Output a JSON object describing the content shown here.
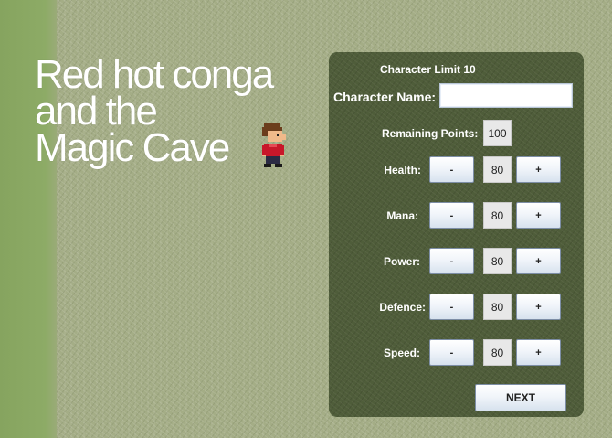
{
  "game": {
    "title_lines": [
      "Red hot conga",
      "and the",
      "Magic Cave"
    ]
  },
  "form": {
    "char_limit_text": "Character Limit 10",
    "name_label": "Character Name:",
    "name_value": "",
    "remaining_label": "Remaining Points:",
    "remaining_value": "100",
    "minus_label": "-",
    "plus_label": "+",
    "stats": [
      {
        "label": "Health:",
        "value": "80"
      },
      {
        "label": "Mana:",
        "value": "80"
      },
      {
        "label": "Power:",
        "value": "80"
      },
      {
        "label": "Defence:",
        "value": "80"
      },
      {
        "label": "Speed:",
        "value": "80"
      }
    ],
    "next_label": "NEXT"
  },
  "colors": {
    "panel": "#4c5a37",
    "button_border": "#7d8ea6",
    "grass": "#a4ad86"
  }
}
